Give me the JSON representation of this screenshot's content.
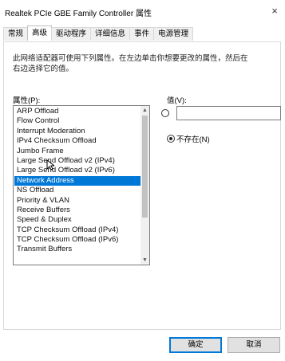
{
  "window": {
    "title": "Realtek PCIe GBE Family Controller 属性",
    "close_glyph": "×"
  },
  "tabs": [
    {
      "label": "常规"
    },
    {
      "label": "高级"
    },
    {
      "label": "驱动程序"
    },
    {
      "label": "详细信息"
    },
    {
      "label": "事件"
    },
    {
      "label": "电源管理"
    }
  ],
  "description": "此网络适配器可使用下列属性。在左边单击你想要更改的属性，然后在右边选择它的值。",
  "property_label": "属性(P):",
  "value_label": "值(V):",
  "properties": [
    "ARP Offload",
    "Flow Control",
    "Interrupt Moderation",
    "IPv4 Checksum Offload",
    "Jumbo Frame",
    "Large Send Offload v2 (IPv4)",
    "Large Send Offload v2 (IPv6)",
    "Network Address",
    "NS Offload",
    "Priority & VLAN",
    "Receive Buffers",
    "Speed & Duplex",
    "TCP Checksum Offload (IPv4)",
    "TCP Checksum Offload (IPv6)",
    "Transmit Buffers"
  ],
  "selected_property": "Network Address",
  "value_input": "",
  "not_present_label": "不存在(N)",
  "buttons": {
    "ok": "确定",
    "cancel": "取消"
  },
  "colors": {
    "selection": "#0078d7",
    "default_button_border": "#0078d7"
  }
}
